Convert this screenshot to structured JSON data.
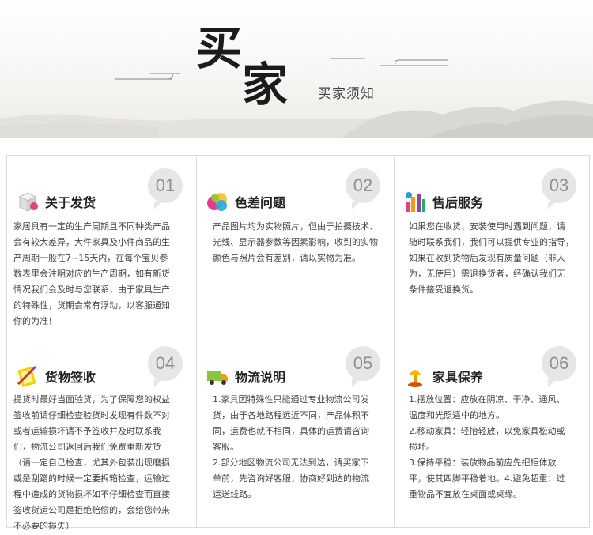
{
  "header": {
    "title_char1": "买",
    "title_char2": "家",
    "subtitle": "买家须知"
  },
  "sections": [
    {
      "number": "01",
      "title": "关于发货",
      "icon": "package-icon",
      "lines": [
        "家居具有一定的生产周期且不同种类产品",
        "会有较大差异，大件家具及小件商品的生",
        "产周期一般在7~15天内，在每个宝贝参",
        "数表里会注明对应的生产周期，如有新货",
        "情况我们会及时与您联系，由于家具生产",
        "的特殊性，货期会常有浮动，以客服通知",
        "你的为准！"
      ]
    },
    {
      "number": "02",
      "title": "色差问题",
      "icon": "color-palette-icon",
      "lines": [
        "产品图片均为实物照片，但由于拍摄技术、",
        "光线、显示器参数等因素影响，收到的实物",
        "颜色与照片会有差别，请以实物为准。"
      ]
    },
    {
      "number": "03",
      "title": "售后服务",
      "icon": "bar-chart-icon",
      "lines": [
        "如果您在收货、安装使用时遇到问题，请",
        "随时联系我们，我们可以提供专业的指导，",
        "如果在收到货物后发现有质量问题（非人",
        "为，无使用）需退换货者，经确认我们无",
        "条件接受退换货。"
      ]
    },
    {
      "number": "04",
      "title": "货物签收",
      "icon": "sign-pen-icon",
      "lines": [
        "提货时最好当面验货，为了保障您的权益",
        "签收前请仔细检查验货时发现有件数不对",
        "或者运输损坏请不予签收并及时联系我",
        "们，物流公司返回后我们免费重新发货",
        "（请一定自己检查，尤其外包装出现磨损",
        "或是刮蹭的时候一定要拆箱检查，运输过",
        "程中造成的货物损坏如不仔细检查而直接",
        "签收货运公司是拒绝赔偿的，会给您带来",
        "不必要的损失）"
      ]
    },
    {
      "number": "05",
      "title": "物流说明",
      "icon": "delivery-truck-icon",
      "lines": [
        "1.家具因特殊性只能通过专业物流公司发",
        "货，由于各地路程远近不同，产品体积不",
        "同，运费也就不相同，具体的运费请咨询",
        "客服。",
        "2.部分地区物流公司无法到达，请买家下",
        "单前，先咨询好客服，协商好到达的物流",
        "运送线路。"
      ]
    },
    {
      "number": "06",
      "title": "家具保养",
      "icon": "lamp-icon",
      "lines": [
        "1.摆放位置：应放在阴凉、干净、通风、",
        "温度和光照适中的地方。",
        "2.移动家具：轻抬轻放，以免家具松动或",
        "损坏。",
        "3.保持平稳：装放物品前应先把柜体放",
        "平，使其四脚平稳着地。4.避免超重：过",
        "重物品不宜放在桌面或桌缘。"
      ]
    }
  ]
}
